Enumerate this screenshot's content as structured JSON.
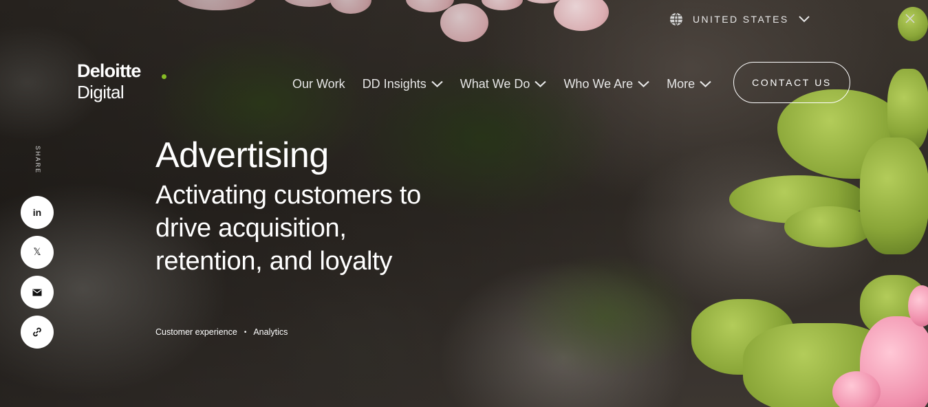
{
  "top_bar": {
    "region_label": "UNITED STATES",
    "region_icon": "globe-icon",
    "close_icon": "close-icon"
  },
  "logo": {
    "line1": "Deloitte",
    "line2": "Digital",
    "dot_color": "#86bc25"
  },
  "nav": {
    "items": [
      {
        "label": "Our Work",
        "has_dropdown": false
      },
      {
        "label": "DD Insights",
        "has_dropdown": true
      },
      {
        "label": "What We Do",
        "has_dropdown": true
      },
      {
        "label": "Who We Are",
        "has_dropdown": true
      },
      {
        "label": "More",
        "has_dropdown": true
      }
    ],
    "contact_label": "CONTACT US"
  },
  "share": {
    "label": "SHARE",
    "buttons": [
      {
        "icon": "linkedin-icon",
        "glyph": "in"
      },
      {
        "icon": "x-icon",
        "glyph": "𝕏"
      },
      {
        "icon": "mail-icon"
      },
      {
        "icon": "link-icon"
      }
    ]
  },
  "hero": {
    "title": "Advertising",
    "subtitle": "Activating customers to drive acquisition, retention, and loyalty",
    "tags": [
      "Customer experience",
      "Analytics"
    ],
    "tag_separator": "•"
  }
}
